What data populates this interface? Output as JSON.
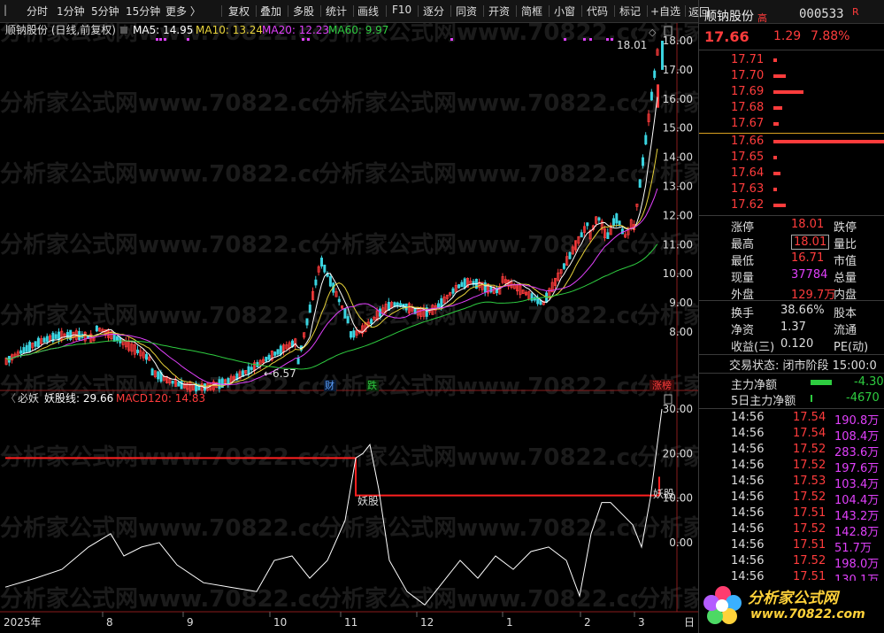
{
  "toolbar": {
    "left_items": [
      "分时",
      "1分钟",
      "5分钟",
      "15分钟",
      "更多 〉"
    ],
    "right_items": [
      "复权",
      "叠加",
      "多股",
      "统计",
      "画线",
      "F10",
      "逐分",
      "同资",
      "开资",
      "简框",
      "小窗",
      "代码",
      "标记",
      "+自选",
      "返回"
    ]
  },
  "main_chart": {
    "title": "顺钠股份 (日线,前复权)",
    "ma": [
      {
        "label": "MA5: 14.95",
        "color": "#ffffff"
      },
      {
        "label": "MA10: 13.24",
        "color": "#e8d33a"
      },
      {
        "label": "MA20: 12.23",
        "color": "#e040fb"
      },
      {
        "label": "MA60: 9.97",
        "color": "#2ecc40"
      }
    ],
    "y_ticks": [
      "18.00",
      "17.00",
      "16.00",
      "15.00",
      "14.00",
      "13.00",
      "12.00",
      "11.00",
      "10.00",
      "9.00",
      "8.00"
    ],
    "high_label": "18.01",
    "low_label": "←6.57",
    "markers": [
      {
        "text": "财",
        "color": "#5aa0ff"
      },
      {
        "text": "跌",
        "color": "#2ecc40"
      },
      {
        "text": "涨榜",
        "color": "#ff3c3c"
      }
    ]
  },
  "sub_chart": {
    "title": "必妖",
    "line1": "妖股线: 29.66",
    "line2": "MACD120: 14.83",
    "y_ticks": [
      "30.00",
      "20.00",
      "10.00",
      "0.00"
    ],
    "annotations": [
      "妖股",
      "妖股"
    ]
  },
  "x_axis": [
    "2025年",
    "8",
    "9",
    "10",
    "11",
    "12",
    "1",
    "2",
    "3",
    "日"
  ],
  "quote": {
    "name": "顺钠股份",
    "high_tag": "高",
    "code": "000533",
    "r_tag": "R",
    "price": "17.66",
    "change": "1.29",
    "change_pct": "7.88%",
    "asks": [
      "17.71",
      "17.70",
      "17.69",
      "17.68",
      "17.67"
    ],
    "bids": [
      "17.66",
      "17.65",
      "17.64",
      "17.63",
      "17.62"
    ],
    "stats": [
      {
        "l1": "涨停",
        "v1": "18.01",
        "l2": "跌停",
        "v2": ""
      },
      {
        "l1": "最高",
        "v1": "18.01",
        "l2": "量比",
        "v2": ""
      },
      {
        "l1": "最低",
        "v1": "16.71",
        "l2": "市值",
        "v2": ""
      },
      {
        "l1": "现量",
        "v1": "37784",
        "l2": "总量",
        "v2": ""
      },
      {
        "l1": "外盘",
        "v1": "129.7万",
        "l2": "内盘",
        "v2": ""
      }
    ],
    "stats2": [
      {
        "l1": "换手",
        "v1": "38.66%",
        "l2": "股本"
      },
      {
        "l1": "净资",
        "v1": "1.37",
        "l2": "流通"
      },
      {
        "l1": "收益(三)",
        "v1": "0.120",
        "l2": "PE(动)"
      }
    ],
    "trade_status": "交易状态: 闭市阶段 15:00:0",
    "flow": [
      {
        "label": "主力净额",
        "value": "-4.30"
      },
      {
        "label": "5日主力净额",
        "value": "-4670"
      }
    ],
    "ticks": [
      {
        "t": "14:56",
        "p": "17.54",
        "v": "190.8万"
      },
      {
        "t": "14:56",
        "p": "17.54",
        "v": "108.4万"
      },
      {
        "t": "14:56",
        "p": "17.52",
        "v": "283.6万"
      },
      {
        "t": "14:56",
        "p": "17.52",
        "v": "197.6万"
      },
      {
        "t": "14:56",
        "p": "17.53",
        "v": "103.4万"
      },
      {
        "t": "14:56",
        "p": "17.52",
        "v": "104.4万"
      },
      {
        "t": "14:56",
        "p": "17.51",
        "v": "143.2万"
      },
      {
        "t": "14:56",
        "p": "17.52",
        "v": "142.8万"
      },
      {
        "t": "14:56",
        "p": "17.51",
        "v": "51.7万"
      },
      {
        "t": "14:56",
        "p": "17.52",
        "v": "198.0万"
      },
      {
        "t": "14:56",
        "p": "17.51",
        "v": "130.1万"
      }
    ]
  },
  "watermark": "分析家公式网www.70822.com",
  "logo": {
    "text": "分析家公式网",
    "url": "www.70822.com"
  }
}
